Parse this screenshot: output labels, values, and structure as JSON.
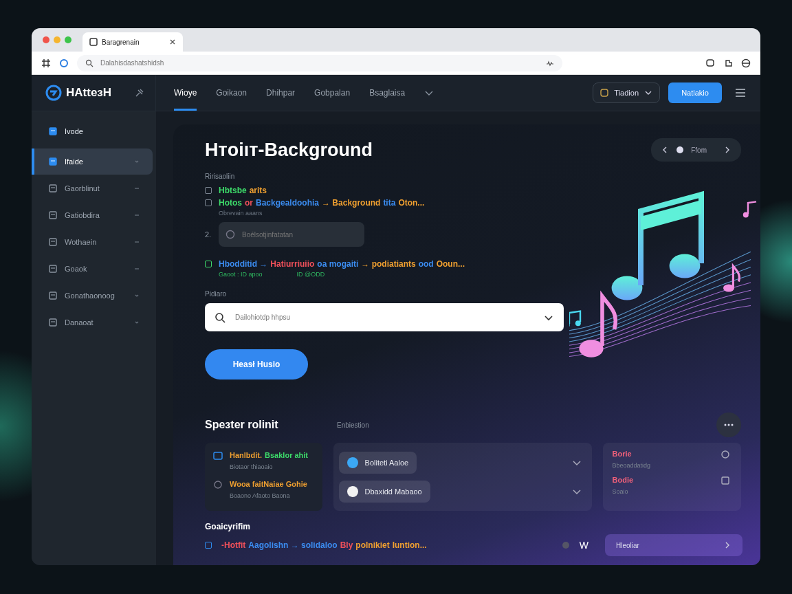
{
  "browser": {
    "tab_title": "Baragrenain",
    "address_placeholder": "Dalahisdashatshidsh"
  },
  "app": {
    "logo": "HAtteзH",
    "nav": [
      {
        "label": "Wioye",
        "selected": true
      },
      {
        "label": "Goikaon",
        "selected": false
      },
      {
        "label": "Dhihpar",
        "selected": false
      },
      {
        "label": "Gobpalan",
        "selected": false
      },
      {
        "label": "Bsaglaisa",
        "selected": false
      }
    ],
    "dropdown": "Tiadion",
    "primary_button": "Natlakio"
  },
  "sidebar": {
    "items": [
      {
        "label": "Ivode",
        "kind": "heading",
        "selected": false
      },
      {
        "label": "Ifaide",
        "kind": "item",
        "selected": true,
        "expanded": false
      },
      {
        "label": "Gaorblinut",
        "kind": "item",
        "selected": false,
        "expanded": true
      },
      {
        "label": "Gatiobdira",
        "kind": "item",
        "selected": false,
        "expanded": true
      },
      {
        "label": "Wothaein",
        "kind": "item",
        "selected": false,
        "expanded": true
      },
      {
        "label": "Goaok",
        "kind": "item",
        "selected": false,
        "expanded": true
      },
      {
        "label": "Gonathaonoog",
        "kind": "item",
        "selected": false,
        "expanded": false
      },
      {
        "label": "Danaoat",
        "kind": "item",
        "selected": false,
        "expanded": false
      }
    ]
  },
  "main": {
    "title": "Hтoiıт-Background",
    "pager": "Ffom",
    "subheading": "Ririsaoliin",
    "tasks": [
      {
        "kind": "check",
        "checked": false,
        "segments": [
          {
            "text": "Hbtsbe",
            "color": "#3ddc6a"
          },
          {
            "text": "arits",
            "color": "#f0a030"
          }
        ]
      },
      {
        "kind": "check",
        "checked": false,
        "segments": [
          {
            "text": "Hotos",
            "color": "#3ddc6a"
          },
          {
            "text": "or",
            "color": "#f0505a"
          },
          {
            "text": "Backgealdoohia",
            "color": "#3b8cf0"
          },
          {
            "text": "→ Background",
            "color": "#f0a030"
          },
          {
            "text": "tita",
            "color": "#3b8cf0"
          },
          {
            "text": "Oton...",
            "color": "#f0a030"
          }
        ],
        "note": "Obrevain aaans"
      },
      {
        "kind": "field",
        "number": "2.",
        "placeholder": "Boélsotjinfatatan"
      },
      {
        "kind": "check",
        "checked": false,
        "color": "#3ddc6a",
        "segments": [
          {
            "text": "Hbodditid →",
            "color": "#3b8cf0"
          },
          {
            "text": "Hatiurriuiio",
            "color": "#f0505a"
          },
          {
            "text": "oa mogaiti",
            "color": "#3b8cf0"
          },
          {
            "text": "→ podiatiants",
            "color": "#f0a030"
          },
          {
            "text": "ood",
            "color": "#3b8cf0"
          },
          {
            "text": "Ooun...",
            "color": "#f0a030"
          }
        ],
        "meta": [
          "Gaoot : ID apoo",
          "ID @ODD"
        ]
      }
    ],
    "select_label": "Pidiaro",
    "select_placeholder": "Dailohiotdp hhpsu",
    "action_button": "Heasł Husio"
  },
  "section": {
    "title": "Speзter rolinit",
    "subtitle": "Enbiestion",
    "card_1": [
      {
        "title": [
          {
            "text": "Hanlbdit.",
            "color": "#f0a030"
          },
          {
            "text": "Bsaklor аhit",
            "color": "#3ddc6a"
          }
        ],
        "subtitle": "Biotaor thiaoaio"
      },
      {
        "title": [
          {
            "text": "Wooa faitNaiae Gohie",
            "color": "#f0a030"
          }
        ],
        "subtitle": "Boaono Afaoto Baona"
      }
    ],
    "card_2": [
      {
        "label": "Boliteti Aaloe",
        "color": "#3ba8f5"
      },
      {
        "label": "Dbaxidd Mabaoo",
        "color": "#f2f2f2"
      }
    ],
    "card_3": [
      {
        "label": "Borie",
        "subtitle": "Bbeoaddatidg",
        "kind": "circle"
      },
      {
        "label": "Bodie",
        "subtitle": "Soaio",
        "kind": "square"
      }
    ]
  },
  "bottom": {
    "title": "Goaicyrifim",
    "task": [
      {
        "text": "-Hotfit",
        "color": "#f0505a"
      },
      {
        "text": "Aagolishn → solidaloo",
        "color": "#3b8cf0"
      },
      {
        "text": "Bly",
        "color": "#f0505a"
      },
      {
        "text": "polnikiet",
        "color": "#f0a030"
      },
      {
        "text": "Iuntion...",
        "color": "#f0a030"
      }
    ],
    "task_checked": false,
    "letter": "W",
    "button": "Hleoliar"
  }
}
